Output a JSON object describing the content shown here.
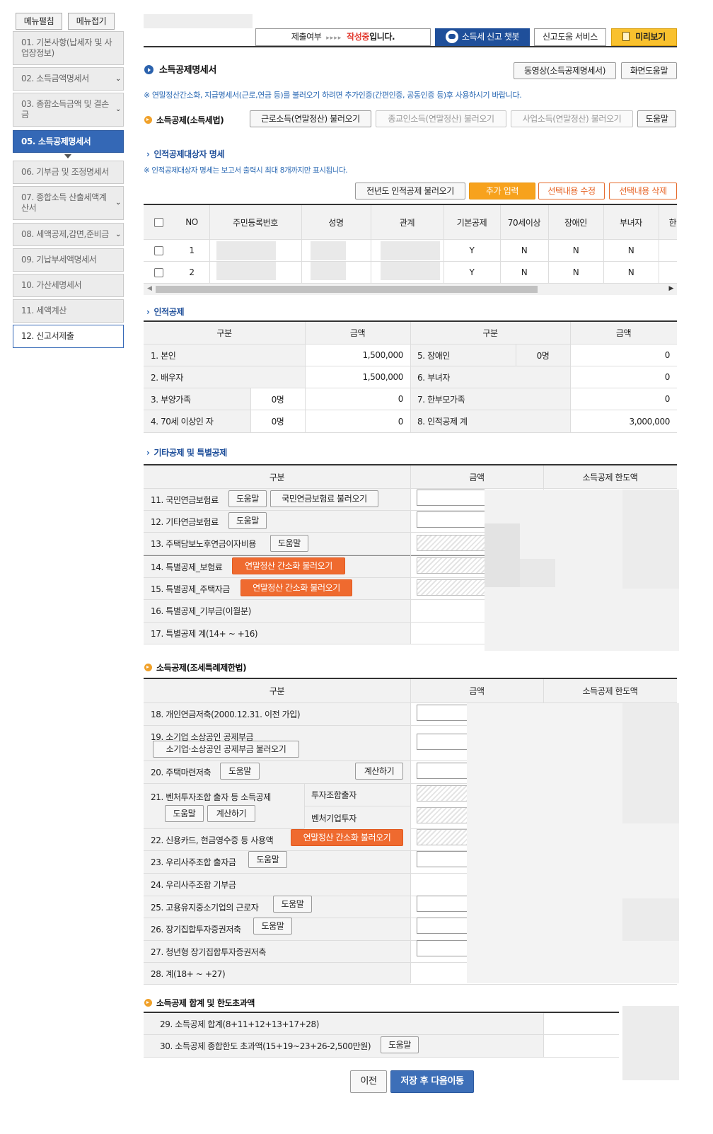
{
  "sidebar": {
    "expand_label": "메뉴펼침",
    "collapse_label": "메뉴접기",
    "items": [
      {
        "label": "01. 기본사항(납세자 및 사업장정보)"
      },
      {
        "label": "02. 소득금액명세서"
      },
      {
        "label": "03. 종합소득금액 및 결손금"
      },
      {
        "label": "05. 소득공제명세서"
      },
      {
        "label": "06. 기부금 및 조정명세서"
      },
      {
        "label": "07. 종합소득 산출세액계산서"
      },
      {
        "label": "08. 세액공제,감면,준비금"
      },
      {
        "label": "09. 기납부세액명세서"
      },
      {
        "label": "10. 가산세명세서"
      },
      {
        "label": "11. 세액계산"
      },
      {
        "label": "12. 신고서제출"
      }
    ]
  },
  "topbar": {
    "status_prefix": "제출여부",
    "status_arrows": "▸▸▸▸",
    "status_value": "작성중",
    "status_suffix": "입니다.",
    "chatbot_label": "소득세 신고 챗봇",
    "help_service_label": "신고도움 서비스",
    "preview_label": "미리보기"
  },
  "page": {
    "title": "소득공제명세서",
    "video_label": "동영상(소득공제명세서)",
    "screen_help_label": "화면도움말",
    "notice": "※ 연말정산간소화, 지급명세서(근로,연금 등)를 불러오기 하려면 추가인증(간편인증, 공동인증 등)후 사용하시기 바랍니다."
  },
  "income_deduction": {
    "title": "소득공제(소득세법)",
    "load_wage": "근로소득(연말정산) 불러오기",
    "load_religious": "종교인소득(연말정산) 불러오기",
    "load_business": "사업소득(연말정산) 불러오기",
    "help": "도움말"
  },
  "dependents": {
    "title": "인적공제대상자 명세",
    "notice": "※ 인적공제대상자 명세는 보고서 출력시 최대 8개까지만 표시됩니다.",
    "btn_prev_year": "전년도 인적공제 불러오기",
    "btn_add": "추가 입력",
    "btn_edit": "선택내용 수정",
    "btn_delete": "선택내용 삭제",
    "headers": [
      "NO",
      "주민등록번호",
      "성명",
      "관계",
      "기본공제",
      "70세이상",
      "장애인",
      "부녀자",
      "한"
    ],
    "rows": [
      {
        "no": "1",
        "basic": "Y",
        "age70": "N",
        "disabled": "N",
        "woman": "N"
      },
      {
        "no": "2",
        "basic": "Y",
        "age70": "N",
        "disabled": "N",
        "woman": "N"
      }
    ]
  },
  "personal": {
    "title": "인적공제",
    "headers": {
      "category": "구분",
      "amount": "금액"
    },
    "left": [
      {
        "label": "1. 본인",
        "sub": "",
        "amount": "1,500,000"
      },
      {
        "label": "2. 배우자",
        "sub": "",
        "amount": "1,500,000"
      },
      {
        "label": "3. 부양가족",
        "sub": "0명",
        "amount": "0"
      },
      {
        "label": "4. 70세 이상인 자",
        "sub": "0명",
        "amount": "0"
      }
    ],
    "right": [
      {
        "label": "5. 장애인",
        "sub": "0명",
        "amount": "0"
      },
      {
        "label": "6. 부녀자",
        "sub": "",
        "amount": "0"
      },
      {
        "label": "7. 한부모가족",
        "sub": "",
        "amount": "0"
      },
      {
        "label": "8. 인적공제 계",
        "sub": "",
        "amount": "3,000,000"
      }
    ]
  },
  "other": {
    "title": "기타공제 및 특별공제",
    "headers": {
      "category": "구분",
      "amount": "금액",
      "limit": "소득공제 한도액"
    },
    "rows": [
      {
        "label": "11. 국민연금보험료",
        "btn1": "도움말",
        "btn2": "국민연금보험료 불러오기"
      },
      {
        "label": "12. 기타연금보험료",
        "btn1": "도움말"
      },
      {
        "label": "13. 주택담보노후연금이자비용",
        "btn1": "도움말"
      },
      {
        "label": "14. 특별공제_보험료",
        "btn_orange": "연말정산 간소화 불러오기"
      },
      {
        "label": "15. 특별공제_주택자금",
        "btn_orange": "연말정산 간소화 불러오기"
      },
      {
        "label": "16. 특별공제_기부금(이월분)"
      },
      {
        "label": "17. 특별공제 계(14+ ~ +16)"
      }
    ]
  },
  "special": {
    "title": "소득공제(조세특례제한법)",
    "headers": {
      "category": "구분",
      "amount": "금액",
      "limit": "소득공제 한도액"
    },
    "rows": {
      "r18": "18. 개인연금저축(2000.12.31. 이전 가입)",
      "r19": "19. 소기업 소상공인 공제부금",
      "r19_btn": "소기업·소상공인 공제부금 불러오기",
      "r20": "20. 주택마련저축",
      "r20_help": "도움말",
      "r20_calc": "계산하기",
      "r21": "21. 벤처투자조합 출자 등 소득공제",
      "r21_help": "도움말",
      "r21_calc": "계산하기",
      "r21_sub1": "투자조합출자",
      "r21_sub2": "벤처기업투자",
      "r22": "22. 신용카드, 현금영수증 등 사용액",
      "r22_btn": "연말정산 간소화 불러오기",
      "r23": "23. 우리사주조합 출자금",
      "r23_help": "도움말",
      "r24": "24. 우리사주조합 기부금",
      "r25": "25. 고용유지중소기업의 근로자",
      "r25_help": "도움말",
      "r26": "26. 장기집합투자증권저축",
      "r26_help": "도움말",
      "r27": "27. 청년형 장기집합투자증권저축",
      "r28": "28. 계(18+ ~ +27)"
    }
  },
  "totals": {
    "title": "소득공제 합계 및 한도초과액",
    "r29": "29. 소득공제 합계(8+11+12+13+17+28)",
    "r30": "30. 소득공제 종합한도 초과액(15+19~23+26-2,500만원)",
    "r30_help": "도움말"
  },
  "footer": {
    "prev": "이전",
    "save_next": "저장 후 다음이동"
  }
}
